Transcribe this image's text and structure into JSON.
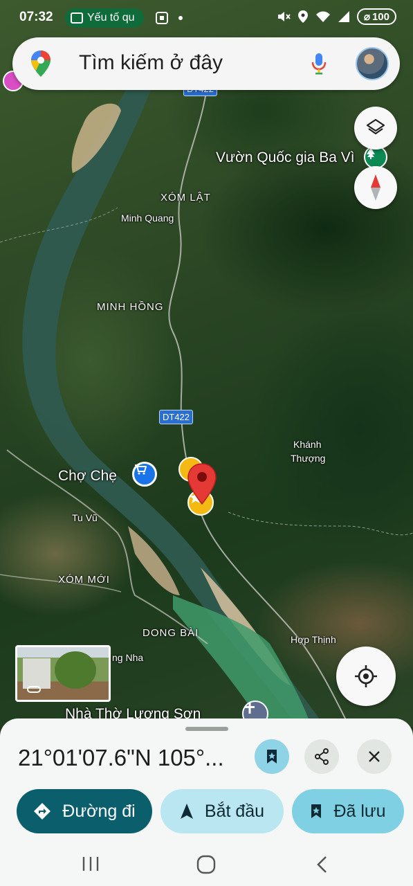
{
  "status_bar": {
    "time": "07:32",
    "app_chip_label": "Yếu tố qu",
    "battery": "100",
    "icons": [
      "cast-icon",
      "dot-icon",
      "mute-icon",
      "location-icon",
      "wifi-icon",
      "signal-icon",
      "battery-icon"
    ]
  },
  "search": {
    "placeholder": "Tìm kiếm ở đây",
    "icons": [
      "maps-pin-logo",
      "mic-icon",
      "avatar"
    ]
  },
  "map": {
    "labels": {
      "park": "Vườn Quốc gia Ba Vì",
      "xom_lat": "XÓM LẬT",
      "minh_quang": "Minh Quang",
      "minh_hong": "MINH HỒNG",
      "cho_che": "Chợ Chẹ",
      "khanh_thuong_1": "Khánh",
      "khanh_thuong_2": "Thượng",
      "tu_vu": "Tu Vũ",
      "xom_moi": "XÓM MỚI",
      "dong_bai": "DONG BÀI",
      "hop_thinh": "Hợp Thịnh",
      "nha_tho": "Nhà Thờ Lương Sơn",
      "partial_nha": "ng Nha"
    },
    "road_shields": [
      "DT422",
      "DT422"
    ],
    "colors": {
      "road_shield": "#2a6ed0",
      "pin": "#e53935",
      "star_marker": "#f5b914",
      "park_marker": "#0b8a54",
      "shop_marker": "#1a73e8"
    }
  },
  "controls": {
    "icons": [
      "layers-icon",
      "compass-icon",
      "my-location-icon"
    ]
  },
  "sheet": {
    "coordinates": "21°01'07.6\"N 105°...",
    "buttons": {
      "directions": "Đường đi",
      "start": "Bắt đầu",
      "saved": "Đã lưu"
    },
    "icons": [
      "bookmark-icon",
      "share-icon",
      "close-icon"
    ],
    "colors": {
      "primary": "#0b5e6b",
      "secondary": "#b9e6f0",
      "saved_bg": "#7fd0e3"
    }
  },
  "navigation": {
    "icons": [
      "recent-apps-icon",
      "home-icon",
      "back-icon"
    ]
  }
}
